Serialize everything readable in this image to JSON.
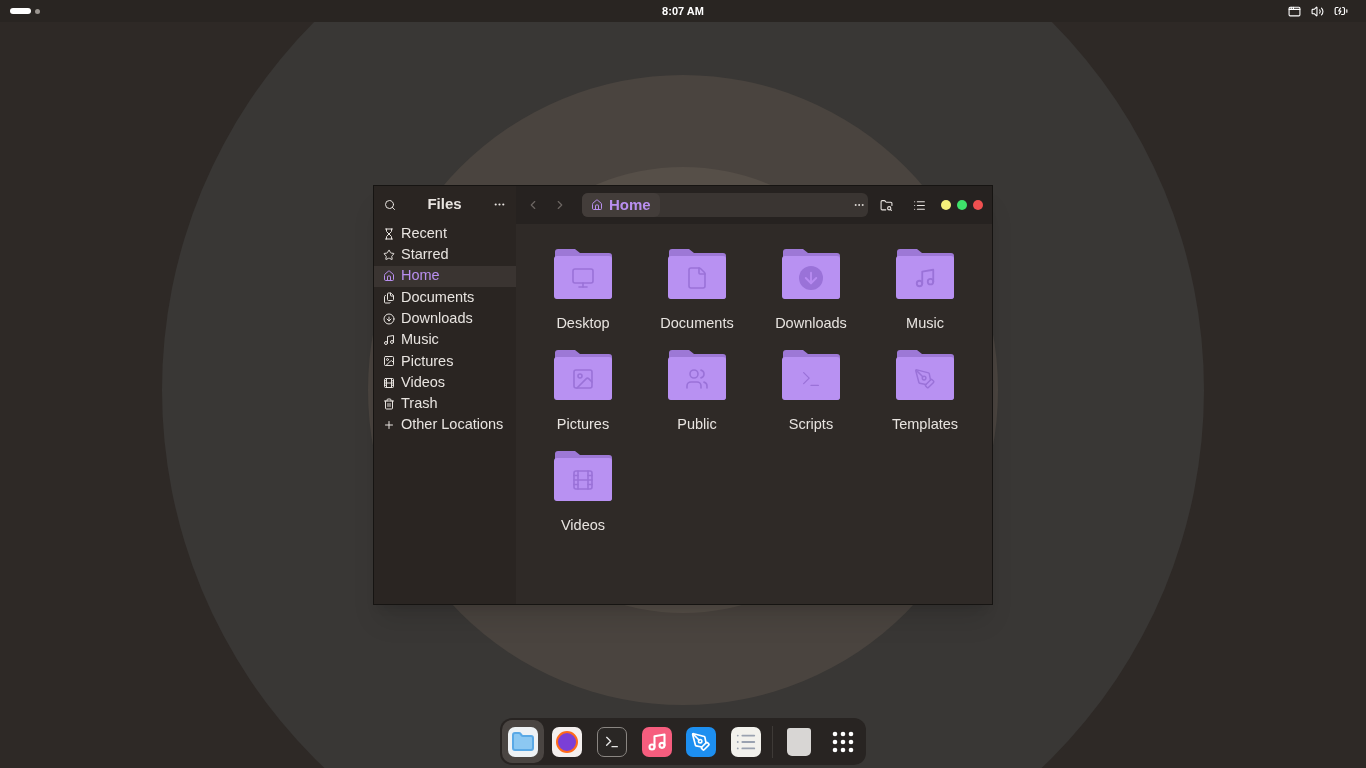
{
  "top_bar": {
    "clock": "8:07 AM",
    "workspaces": [
      {
        "selected": true
      },
      {
        "selected": false
      }
    ]
  },
  "window": {
    "title": "Files",
    "path": {
      "label": "Home"
    }
  },
  "sidebar": {
    "items": [
      {
        "label": "Recent",
        "kind": "recent",
        "selected": false
      },
      {
        "label": "Starred",
        "kind": "starred",
        "selected": false
      },
      {
        "label": "Home",
        "kind": "home",
        "selected": true
      },
      {
        "label": "Documents",
        "kind": "documents",
        "selected": false
      },
      {
        "label": "Downloads",
        "kind": "downloads",
        "selected": false
      },
      {
        "label": "Music",
        "kind": "music",
        "selected": false
      },
      {
        "label": "Pictures",
        "kind": "pictures",
        "selected": false
      },
      {
        "label": "Videos",
        "kind": "videos",
        "selected": false
      },
      {
        "label": "Trash",
        "kind": "trash",
        "selected": false
      },
      {
        "label": "Other Locations",
        "kind": "other",
        "selected": false
      }
    ]
  },
  "folders": [
    {
      "label": "Desktop",
      "kind": "desktop"
    },
    {
      "label": "Documents",
      "kind": "documents"
    },
    {
      "label": "Downloads",
      "kind": "downloads"
    },
    {
      "label": "Music",
      "kind": "music"
    },
    {
      "label": "Pictures",
      "kind": "pictures"
    },
    {
      "label": "Public",
      "kind": "public"
    },
    {
      "label": "Scripts",
      "kind": "scripts"
    },
    {
      "label": "Templates",
      "kind": "templates"
    },
    {
      "label": "Videos",
      "kind": "videos"
    }
  ],
  "dock": {
    "apps": [
      {
        "kind": "files",
        "selected": true
      },
      {
        "kind": "browser",
        "selected": false
      },
      {
        "kind": "terminal",
        "selected": false
      },
      {
        "kind": "music",
        "selected": false
      },
      {
        "kind": "store",
        "selected": false
      },
      {
        "kind": "notes",
        "selected": false
      }
    ],
    "trash": {
      "kind": "trash"
    }
  }
}
